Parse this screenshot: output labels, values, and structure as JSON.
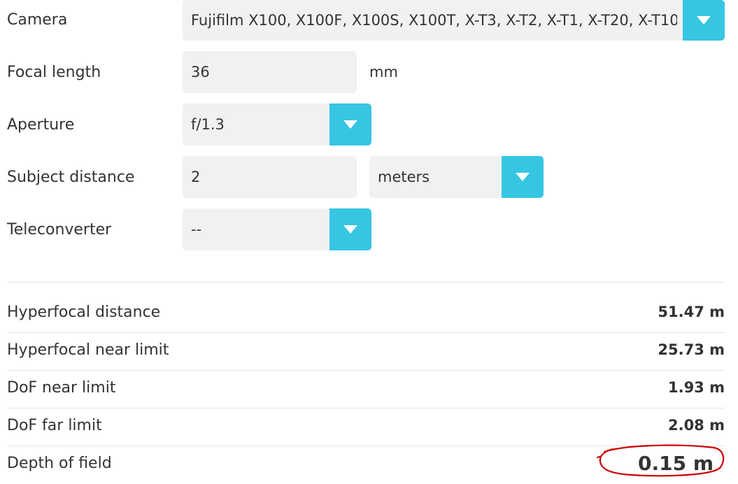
{
  "form": {
    "camera": {
      "label": "Camera",
      "value": "Fujifilm X100, X100F, X100S, X100T, X-T3, X-T2, X-T1, X-T20, X-T10"
    },
    "focal_length": {
      "label": "Focal length",
      "value": "36",
      "unit": "mm"
    },
    "aperture": {
      "label": "Aperture",
      "value": "f/1.3"
    },
    "subject_distance": {
      "label": "Subject distance",
      "value": "2",
      "unit_value": "meters"
    },
    "teleconverter": {
      "label": "Teleconverter",
      "value": "--"
    }
  },
  "results": {
    "hyperfocal_distance": {
      "label": "Hyperfocal distance",
      "value": "51.47 m"
    },
    "hyperfocal_near_limit": {
      "label": "Hyperfocal near limit",
      "value": "25.73 m"
    },
    "dof_near_limit": {
      "label": "DoF near limit",
      "value": "1.93 m"
    },
    "dof_far_limit": {
      "label": "DoF far limit",
      "value": "2.08 m"
    },
    "depth_of_field": {
      "label": "Depth of field",
      "value": "0.15 m"
    }
  },
  "colors": {
    "accent": "#36c6e2",
    "field_bg": "#f1f1f1",
    "annotation": "#cc0000"
  },
  "icons": {
    "dropdown": "chevron-down-icon",
    "annotation": "hand-drawn-circle"
  }
}
